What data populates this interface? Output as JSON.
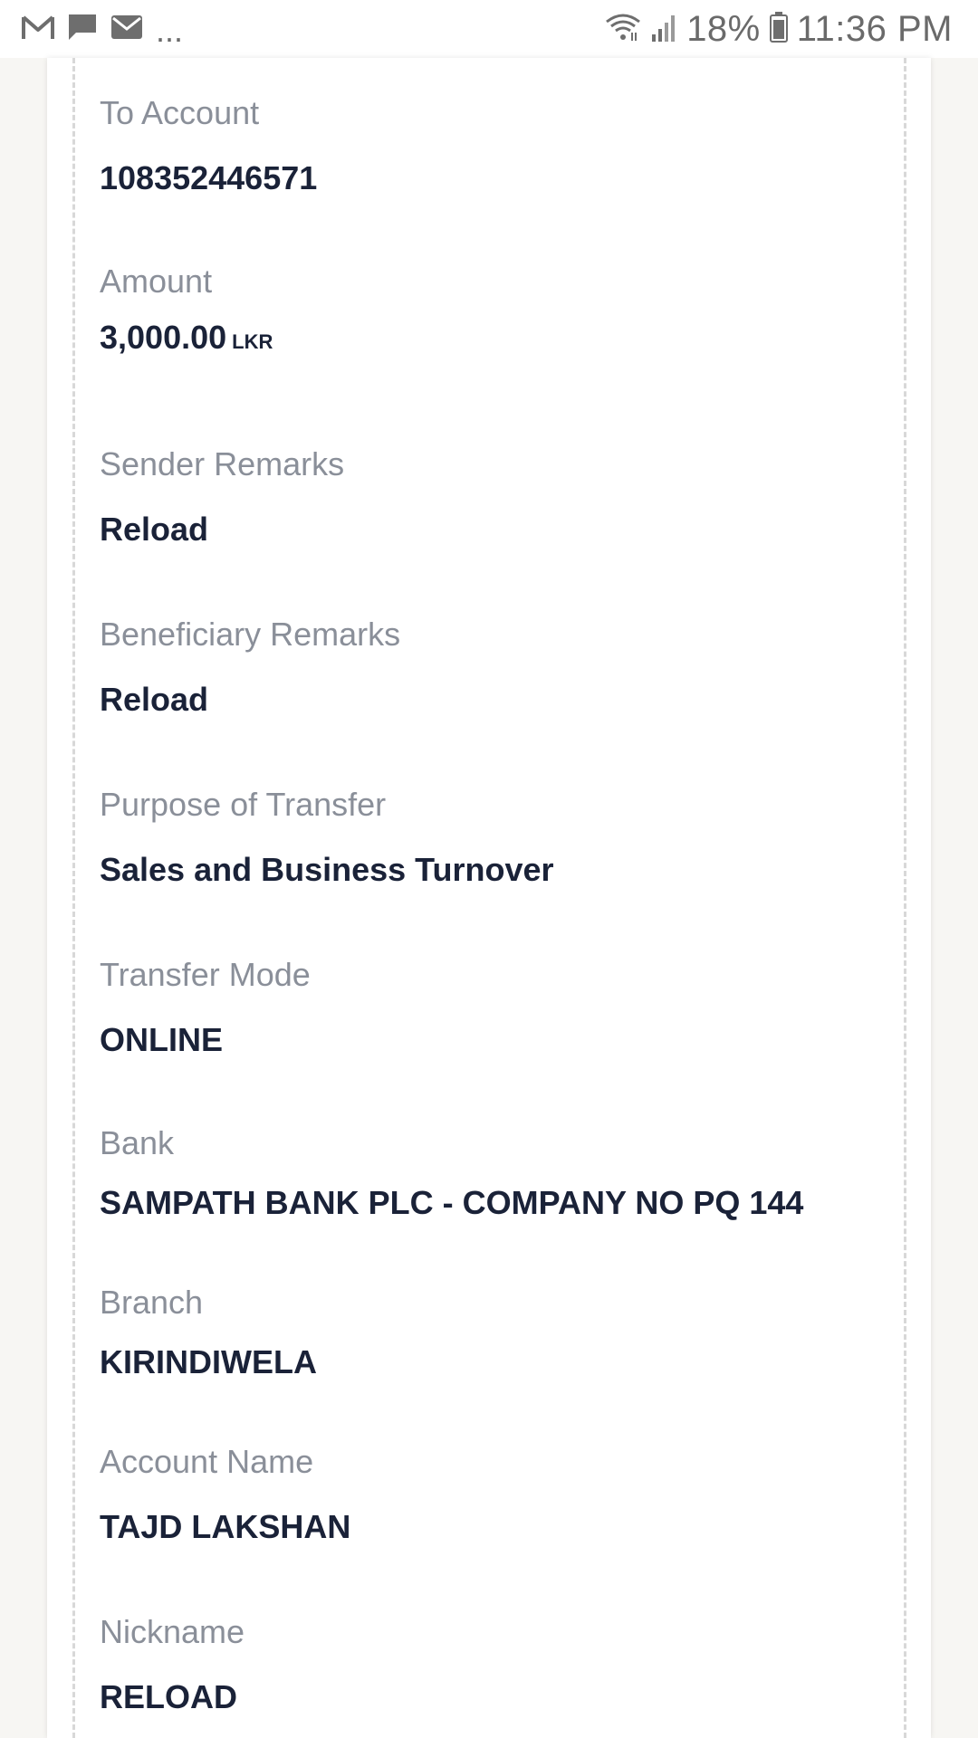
{
  "status_bar": {
    "left_icons": [
      "gmail-icon",
      "message-icon",
      "email-icon"
    ],
    "overflow": "...",
    "battery_percent": "18%",
    "time": "11:36 PM"
  },
  "details": [
    {
      "label": "To Account",
      "value": "108352446571"
    },
    {
      "label": "Amount",
      "value": "3,000.00",
      "unit": "LKR"
    },
    {
      "label": "Sender Remarks",
      "value": "Reload"
    },
    {
      "label": "Beneficiary Remarks",
      "value": "Reload"
    },
    {
      "label": "Purpose of Transfer",
      "value": "Sales and Business Turnover"
    },
    {
      "label": "Transfer Mode",
      "value": "ONLINE"
    },
    {
      "label": "Bank",
      "value": "SAMPATH BANK PLC - COMPANY NO PQ 144"
    },
    {
      "label": "Branch",
      "value": "KIRINDIWELA"
    },
    {
      "label": "Account Name",
      "value": "TAJD LAKSHAN"
    },
    {
      "label": "Nickname",
      "value": "RELOAD"
    }
  ]
}
